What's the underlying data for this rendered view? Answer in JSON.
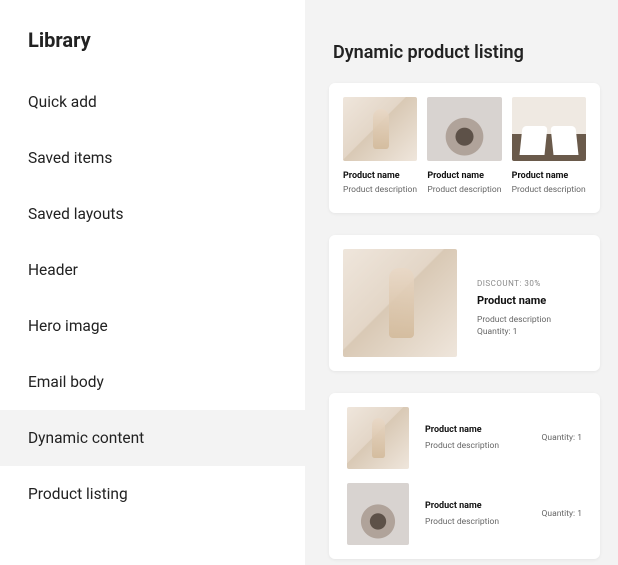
{
  "sidebar": {
    "title": "Library",
    "items": [
      {
        "label": "Quick add"
      },
      {
        "label": "Saved items"
      },
      {
        "label": "Saved layouts"
      },
      {
        "label": "Header"
      },
      {
        "label": "Hero image"
      },
      {
        "label": "Email body"
      },
      {
        "label": "Dynamic content"
      },
      {
        "label": "Product listing"
      }
    ],
    "active_index": 6
  },
  "main": {
    "title": "Dynamic product listing",
    "cardA": {
      "items": [
        {
          "name": "Product name",
          "desc": "Product description",
          "image": "beige"
        },
        {
          "name": "Product name",
          "desc": "Product description",
          "image": "grey"
        },
        {
          "name": "Product name",
          "desc": "Product description",
          "image": "shoes"
        }
      ]
    },
    "cardB": {
      "image": "beige",
      "discount": "DISCOUNT: 30%",
      "name": "Product name",
      "desc": "Product description",
      "qty": "Quantity: 1"
    },
    "cardC": {
      "rows": [
        {
          "image": "beige",
          "name": "Product name",
          "desc": "Product description",
          "qty": "Quantity: 1"
        },
        {
          "image": "grey",
          "name": "Product name",
          "desc": "Product description",
          "qty": "Quantity: 1"
        }
      ]
    }
  }
}
